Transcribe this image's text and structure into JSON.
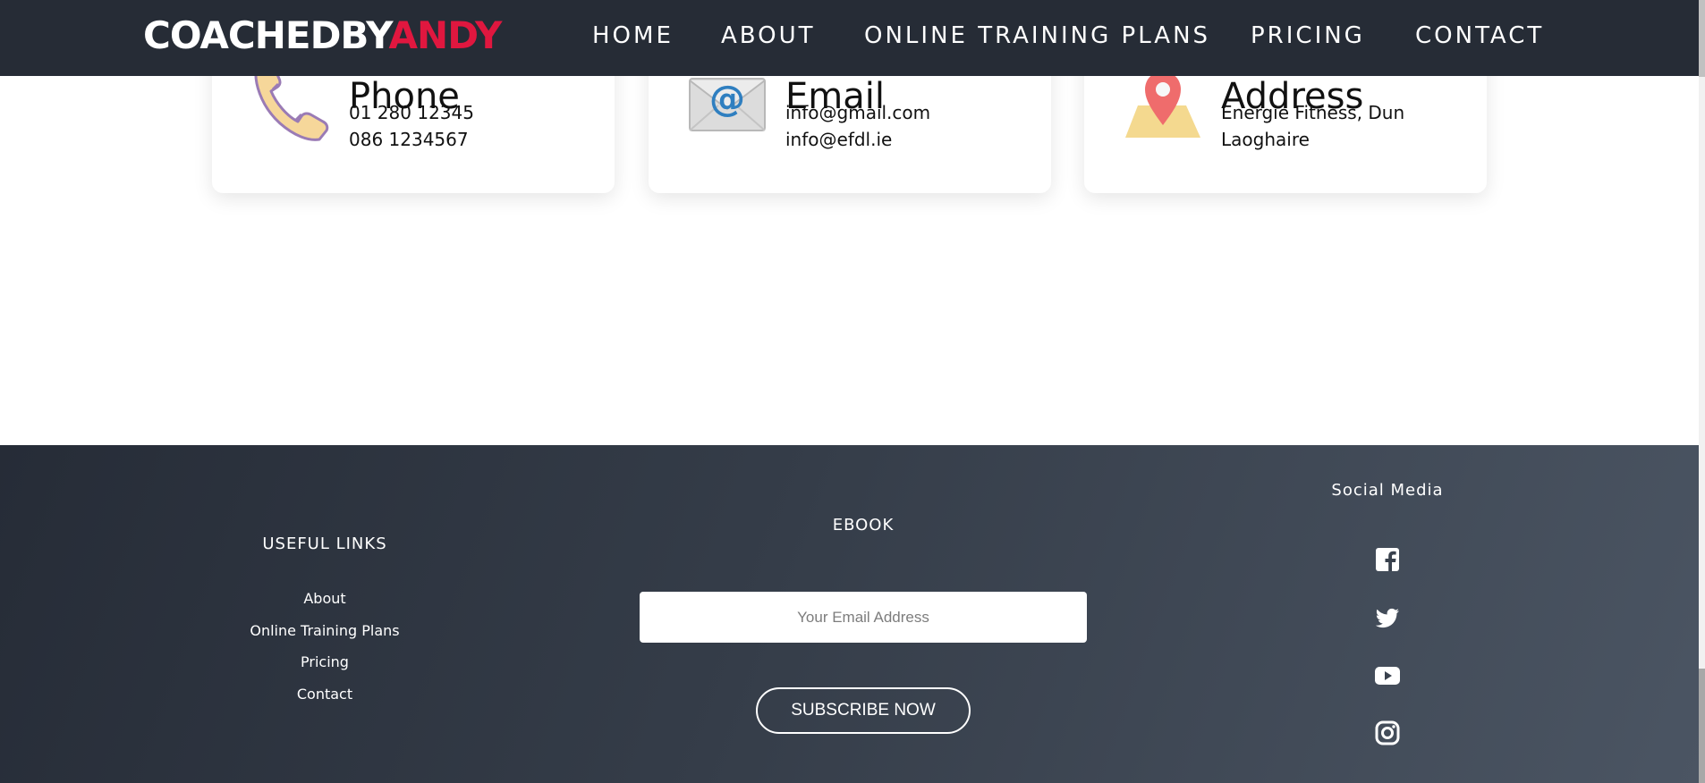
{
  "header": {
    "logo_primary": "COACHEDBY",
    "logo_accent": "ANDY",
    "nav": [
      {
        "label": "HOME"
      },
      {
        "label": "ABOUT"
      },
      {
        "label": "ONLINE TRAINING PLANS"
      },
      {
        "label": "PRICING"
      },
      {
        "label": "CONTACT"
      }
    ]
  },
  "contact_cards": [
    {
      "title": "Phone",
      "icon": "phone-icon",
      "lines": [
        "01 280 12345",
        "086 1234567"
      ]
    },
    {
      "title": "Email",
      "icon": "email-icon",
      "lines": [
        "info@gmail.com",
        "info@efdl.ie"
      ]
    },
    {
      "title": "Address",
      "icon": "map-pin-icon",
      "lines": [
        "Energie Fitness, Dun",
        "Laoghaire"
      ]
    }
  ],
  "footer": {
    "useful_links": {
      "heading": "USEFUL LINKS",
      "links": [
        "About",
        "Online Training Plans",
        "Pricing",
        "Contact"
      ]
    },
    "ebook": {
      "heading": "EBOOK",
      "email_placeholder": "Your Email Address",
      "email_value": "",
      "subscribe_label": "SUBSCRIBE NOW"
    },
    "social": {
      "heading": "Social Media",
      "icons": [
        "facebook-icon",
        "twitter-icon",
        "youtube-icon",
        "instagram-icon"
      ]
    }
  },
  "colors": {
    "header_bg": "#262c36",
    "brand_accent": "#e0173f",
    "footer_gradient_start": "#262c37",
    "footer_gradient_end": "#4b5563"
  }
}
